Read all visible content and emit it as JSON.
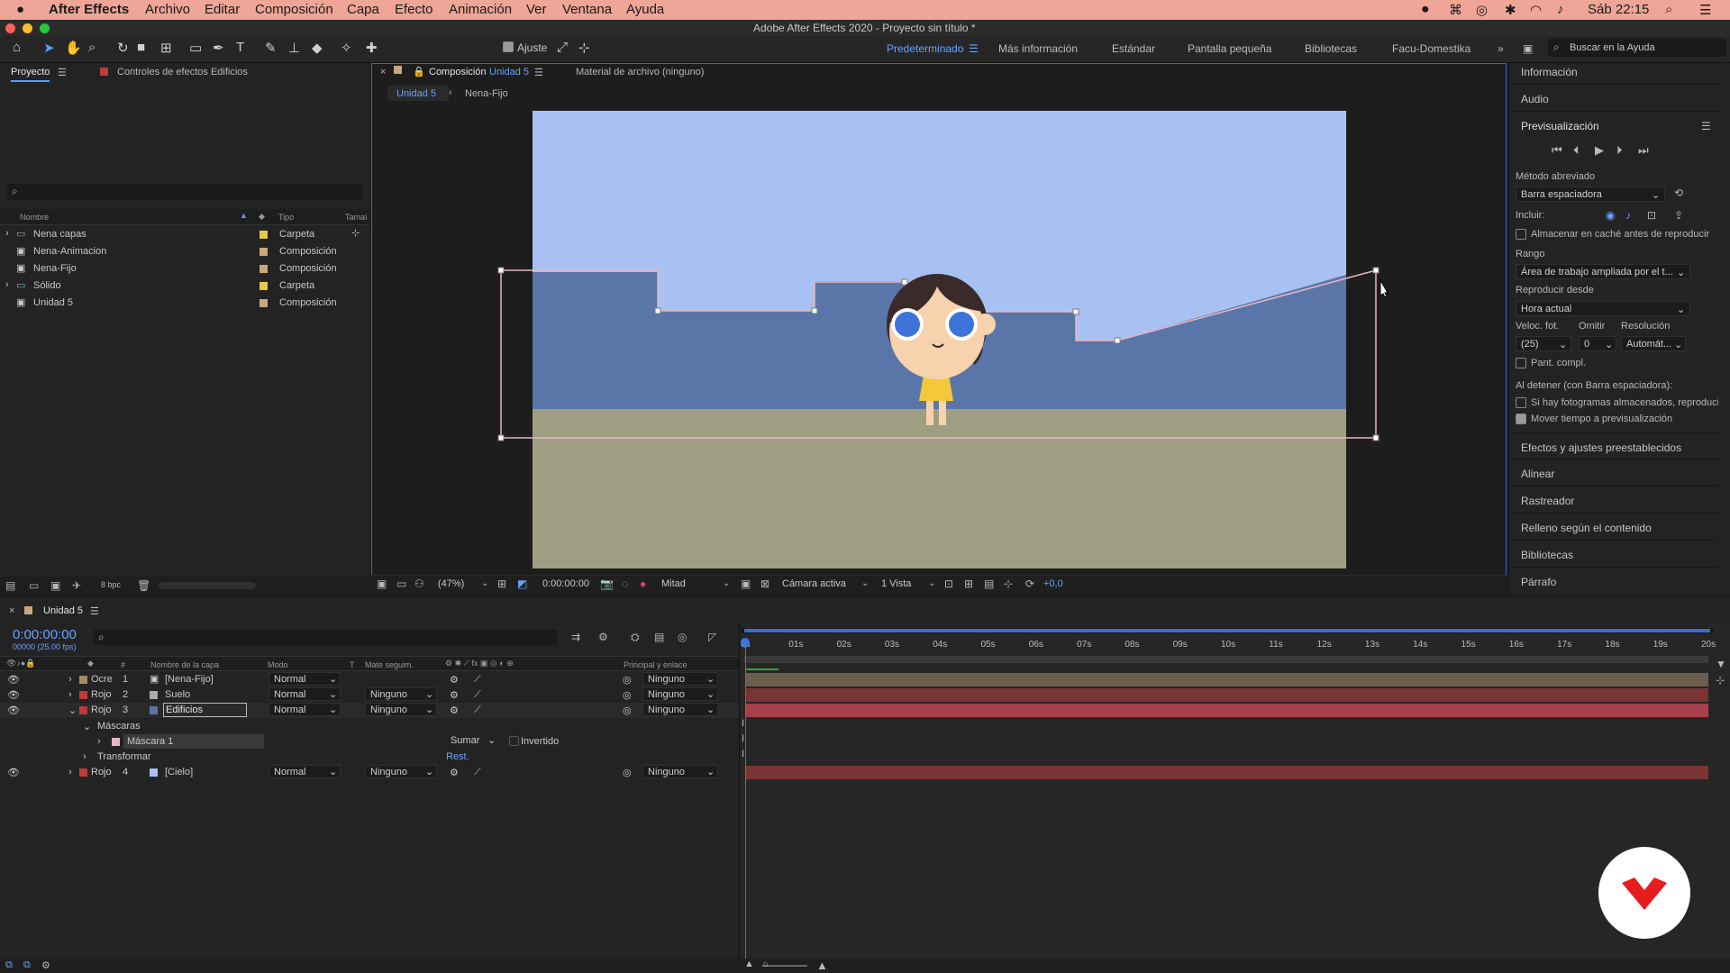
{
  "menubar": {
    "app": "After Effects",
    "items": [
      "Archivo",
      "Editar",
      "Composición",
      "Capa",
      "Efecto",
      "Animación",
      "Ver",
      "Ventana",
      "Ayuda"
    ],
    "clock": "Sáb 22:15"
  },
  "window": {
    "title": "Adobe After Effects 2020 - Proyecto sin título *"
  },
  "toolbar": {
    "snap_label": "Ajuste",
    "workspaces": [
      "Predeterminado",
      "Más información",
      "Estándar",
      "Pantalla pequeña",
      "Bibliotecas",
      "Facu-Domestika"
    ],
    "search_placeholder": "Buscar en la Ayuda"
  },
  "project": {
    "tab": "Proyecto",
    "effects_tab": "Controles de efectos Edificios",
    "columns": {
      "name": "Nombre",
      "type": "Tipo",
      "size": "Tamaí"
    },
    "items": [
      {
        "name": "Nena capas",
        "type": "Carpeta",
        "color": "#e6c84a"
      },
      {
        "name": "Nena-Animacion",
        "type": "Composición",
        "color": "#c9a77c"
      },
      {
        "name": "Nena-Fijo",
        "type": "Composición",
        "color": "#c9a77c"
      },
      {
        "name": "Sólido",
        "type": "Carpeta",
        "color": "#e6c84a"
      },
      {
        "name": "Unidad 5",
        "type": "Composición",
        "color": "#c9a77c"
      }
    ],
    "bpc": "8 bpc"
  },
  "comp": {
    "tab_prefix": "Composición",
    "tab_name": "Unidad 5",
    "footage_tab": "Material de archivo (ninguno)",
    "crumbs": [
      "Unidad 5",
      "Nena-Fijo"
    ],
    "zoom": "(47%)",
    "timecode": "0:00:00:00",
    "resolution": "Mitad",
    "camera": "Cámara activa",
    "views": "1 Vista",
    "exposure": "+0,0"
  },
  "right": {
    "info": "Información",
    "audio": "Audio",
    "preview": "Previsualización",
    "shortcut_label": "Método abreviado",
    "shortcut": "Barra espaciadora",
    "include": "Incluir:",
    "cache": "Almacenar en caché antes de reproducir",
    "range_label": "Rango",
    "range": "Área de trabajo ampliada por el t...",
    "playfrom_label": "Reproducir desde",
    "playfrom": "Hora actual",
    "fps_label": "Veloc. fot.",
    "skip_label": "Omitir",
    "res_label": "Resolución",
    "fps": "(25)",
    "skip": "0",
    "res": "Automát...",
    "fullscreen": "Pant. compl.",
    "onstop": "Al detener (con Barra espaciadora):",
    "ifcached": "Si hay fotogramas almacenados, reproduci",
    "movetime": "Mover tiempo a previsualización",
    "panels": [
      "Efectos y ajustes preestablecidos",
      "Alinear",
      "Rastreador",
      "Relleno según el contenido",
      "Bibliotecas",
      "Párrafo"
    ]
  },
  "timeline": {
    "tab": "Unidad 5",
    "timecode": "0:00:00:00",
    "fps": "00000 (25.00 fps)",
    "headers": {
      "num": "#",
      "name": "Nombre de la capa",
      "mode": "Modo",
      "t": "T",
      "matte": "Mate seguim.",
      "parent": "Principal y enlace"
    },
    "ticks": [
      "0s",
      "01s",
      "02s",
      "03s",
      "04s",
      "05s",
      "06s",
      "07s",
      "08s",
      "09s",
      "10s",
      "11s",
      "12s",
      "13s",
      "14s",
      "15s",
      "16s",
      "17s",
      "18s",
      "19s",
      "20s"
    ],
    "layers": [
      {
        "label": "Ocre",
        "num": "1",
        "name": "[Nena-Fijo]",
        "mode": "Normal",
        "matte": "",
        "parent": "Ninguno",
        "color": "#a8896a",
        "bar": "#6b5e4c"
      },
      {
        "label": "Rojo",
        "num": "2",
        "name": "Suelo",
        "mode": "Normal",
        "matte": "Ninguno",
        "parent": "Ninguno",
        "color": "#c03a3a",
        "bar": "#7a3434"
      },
      {
        "label": "Rojo",
        "num": "3",
        "name": "Edificios",
        "mode": "Normal",
        "matte": "Ninguno",
        "parent": "Ninguno",
        "color": "#c03a3a",
        "bar": "#a8404a"
      },
      {
        "label": "Rojo",
        "num": "4",
        "name": "[Cielo]",
        "mode": "Normal",
        "matte": "Ninguno",
        "parent": "Ninguno",
        "color": "#c03a3a",
        "bar": "#7a3434"
      }
    ],
    "masks": "Máscaras",
    "mask1": "Máscara 1",
    "mask_mode": "Sumar",
    "inverted": "Invertido",
    "transform": "Transformar",
    "reset": "Rest."
  }
}
